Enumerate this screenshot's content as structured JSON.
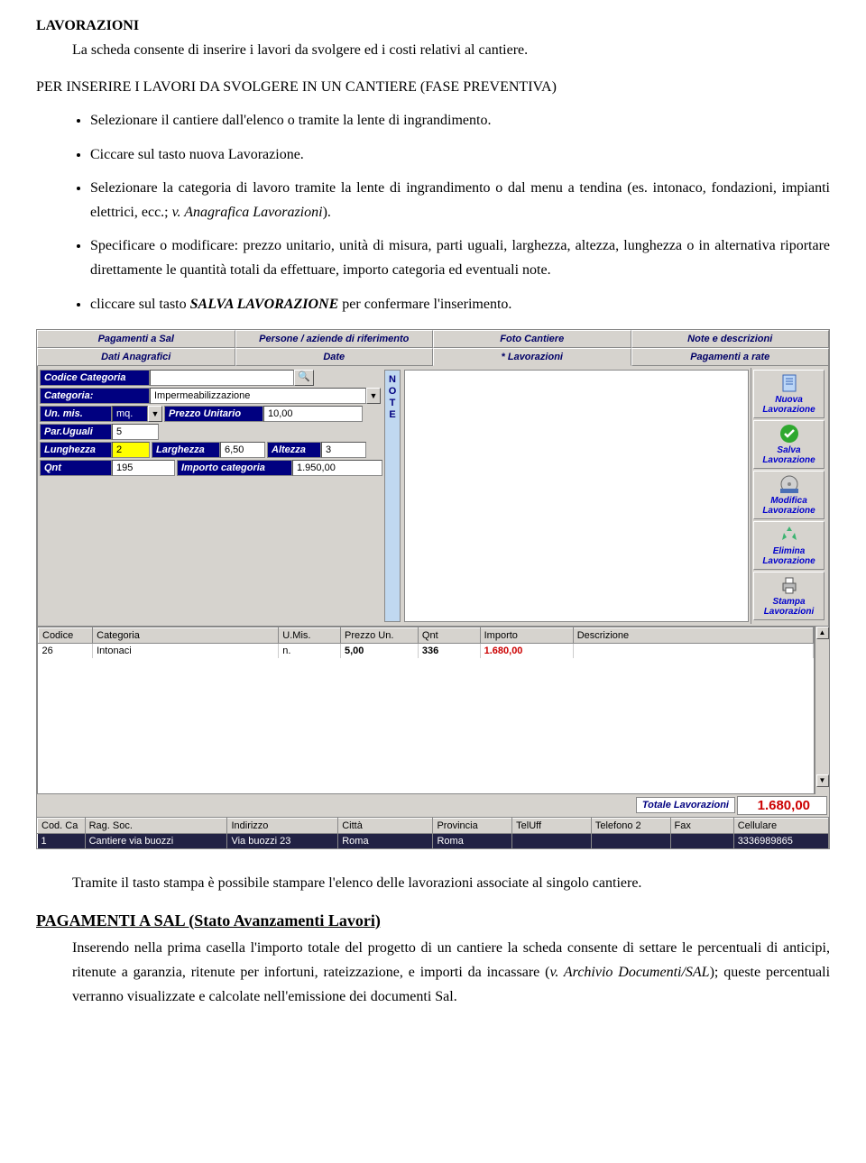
{
  "doc": {
    "title": "LAVORAZIONI",
    "intro": "La scheda consente di inserire i lavori da svolgere ed i costi relativi al cantiere.",
    "subtitle": "PER INSERIRE I LAVORI DA SVOLGERE IN UN CANTIERE (FASE PREVENTIVA)",
    "bullets": {
      "b1": "Selezionare il cantiere dall'elenco o tramite la lente di ingrandimento.",
      "b2": "Ciccare sul tasto nuova Lavorazione.",
      "b3a": "Selezionare la categoria di lavoro tramite la lente di ingrandimento o dal menu a tendina (es. intonaco, fondazioni, impianti elettrici, ecc.; ",
      "b3b": "v. Anagrafica Lavorazioni",
      "b3c": ").",
      "b4": "Specificare o modificare: prezzo unitario, unità di misura, parti uguali, larghezza, altezza, lunghezza o in alternativa riportare direttamente le quantità totali da effettuare, importo categoria ed eventuali note.",
      "b5a": "cliccare sul tasto ",
      "b5b": "SALVA LAVORAZIONE",
      "b5c": " per confermare l'inserimento."
    },
    "afterimg": "Tramite il tasto stampa è possibile stampare l'elenco delle lavorazioni associate al singolo cantiere.",
    "h2": "PAGAMENTI A SAL (Stato Avanzamenti Lavori)",
    "p2a": "Inserendo nella prima casella l'importo totale del progetto di un cantiere la scheda consente di settare le percentuali di anticipi, ritenute a garanzia, ritenute per infortuni, rateizzazione, e importi da incassare (",
    "p2b": "v. Archivio Documenti/SAL",
    "p2c": "); queste percentuali verranno visualizzate e calcolate nell'emissione dei documenti Sal."
  },
  "ui": {
    "tabs_top": [
      "Pagamenti a Sal",
      "Persone / aziende di riferimento",
      "Foto Cantiere",
      "Note e descrizioni"
    ],
    "tabs_bottom": [
      "Dati Anagrafici",
      "Date",
      "* Lavorazioni",
      "Pagamenti a rate"
    ],
    "form": {
      "codice_cat_lbl": "Codice Categoria",
      "codice_cat_val": "",
      "categoria_lbl": "Categoria:",
      "categoria_val": "Impermeabilizzazione",
      "unmis_lbl": "Un. mis.",
      "unmis_val": "mq.",
      "prezzo_lbl": "Prezzo Unitario",
      "prezzo_val": "10,00",
      "paruguali_lbl": "Par.Uguali",
      "paruguali_val": "5",
      "lung_lbl": "Lunghezza",
      "lung_val": "2",
      "larg_lbl": "Larghezza",
      "larg_val": "6,50",
      "alt_lbl": "Altezza",
      "alt_val": "3",
      "qnt_lbl": "Qnt",
      "qnt_val": "195",
      "impcat_lbl": "Importo categoria",
      "impcat_val": "1.950,00",
      "note_letters": [
        "N",
        "O",
        "T",
        "E"
      ]
    },
    "sidebar": {
      "nuova": "Nuova Lavorazione",
      "salva": "Salva Lavorazione",
      "modifica": "Modifica Lavorazione",
      "elimina": "Elimina Lavorazione",
      "stampa": "Stampa Lavorazioni"
    },
    "list": {
      "headers": [
        "Codice",
        "Categoria",
        "U.Mis.",
        "Prezzo Un.",
        "Qnt",
        "Importo",
        "Descrizione"
      ],
      "row": {
        "codice": "26",
        "categoria": "Intonaci",
        "umis": "n.",
        "prezzo": "5,00",
        "qnt": "336",
        "importo": "1.680,00",
        "descr": ""
      }
    },
    "total": {
      "label": "Totale Lavorazioni",
      "value": "1.680,00"
    },
    "footer": {
      "headers": [
        "Cod. Ca",
        "Rag. Soc.",
        "Indirizzo",
        "Città",
        "Provincia",
        "TelUff",
        "Telefono 2",
        "Fax",
        "Cellulare"
      ],
      "row": {
        "cod": "1",
        "rag": "Cantiere via buozzi",
        "ind": "Via buozzi 23",
        "citta": "Roma",
        "prov": "Roma",
        "tel1": "",
        "tel2": "",
        "fax": "",
        "cell": "3336989865"
      }
    }
  }
}
